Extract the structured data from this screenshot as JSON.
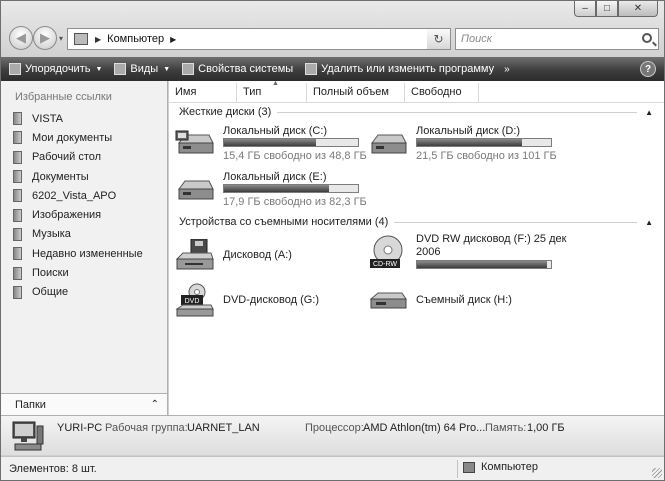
{
  "window": {
    "caption": {
      "minimize": "‒",
      "maximize": "□",
      "close": "✕"
    }
  },
  "nav": {
    "back_glyph": "◀",
    "forward_glyph": "▶",
    "address_sep": "▶",
    "address_text": "Компьютер",
    "address_arrow": "▶",
    "dropdown_glyph": "▾",
    "refresh_glyph": "↻",
    "search_placeholder": "Поиск"
  },
  "toolbar": {
    "organize": "Упорядочить",
    "views": "Виды",
    "properties": "Свойства системы",
    "uninstall": "Удалить или изменить программу",
    "more": "»",
    "help": "?"
  },
  "sidebar": {
    "title": "Избранные ссылки",
    "items": [
      {
        "label": "VISTA"
      },
      {
        "label": "Мои документы"
      },
      {
        "label": "Рабочий стол"
      },
      {
        "label": "Документы"
      },
      {
        "label": "6202_Vista_APO"
      },
      {
        "label": "Изображения"
      },
      {
        "label": "Музыка"
      },
      {
        "label": "Недавно измененные"
      },
      {
        "label": "Поиски"
      },
      {
        "label": "Общие"
      }
    ],
    "folders_label": "Папки",
    "folders_toggle": "⌃"
  },
  "columns": {
    "name": "Имя",
    "type": "Тип",
    "total": "Полный объем",
    "free": "Свободно",
    "sort_glyph": "▲"
  },
  "groups": {
    "hard_disks": "Жесткие диски (3)",
    "removable": "Устройства со съемными носителями (4)",
    "toggle_glyph": "▲"
  },
  "drives": {
    "c": {
      "name": "Локальный диск (C:)",
      "free_text": "15,4 ГБ свободно из 48,8 ГБ",
      "used_fraction": 0.684
    },
    "d": {
      "name": "Локальный диск (D:)",
      "free_text": "21,5 ГБ свободно из 101 ГБ",
      "used_fraction": 0.787
    },
    "e": {
      "name": "Локальный диск (E:)",
      "free_text": "17,9 ГБ свободно из 82,3 ГБ",
      "used_fraction": 0.783
    },
    "a": {
      "name": "Дисковод (A:)"
    },
    "f": {
      "name_line1": "DVD RW дисковод (F:) 25 дек",
      "name_line2": "2006",
      "used_fraction": 0.97,
      "badge": "CD-RW"
    },
    "g": {
      "name": "DVD-дисковод (G:)",
      "badge": "DVD"
    },
    "h": {
      "name": "Съемный диск (H:)"
    }
  },
  "details": {
    "computer_name": "YURI-PC",
    "workgroup_label": "Рабочая группа:",
    "workgroup": "UARNET_LAN",
    "cpu_label": "Процессор:",
    "cpu": "AMD Athlon(tm) 64 Pro...",
    "memory_label": "Память:",
    "memory": "1,00 ГБ"
  },
  "status": {
    "count": "Элементов: 8 шт.",
    "location": "Компьютер"
  },
  "colors": {
    "toolbar": "#3e3e3e",
    "bar_fill": "#3d3d3d"
  }
}
